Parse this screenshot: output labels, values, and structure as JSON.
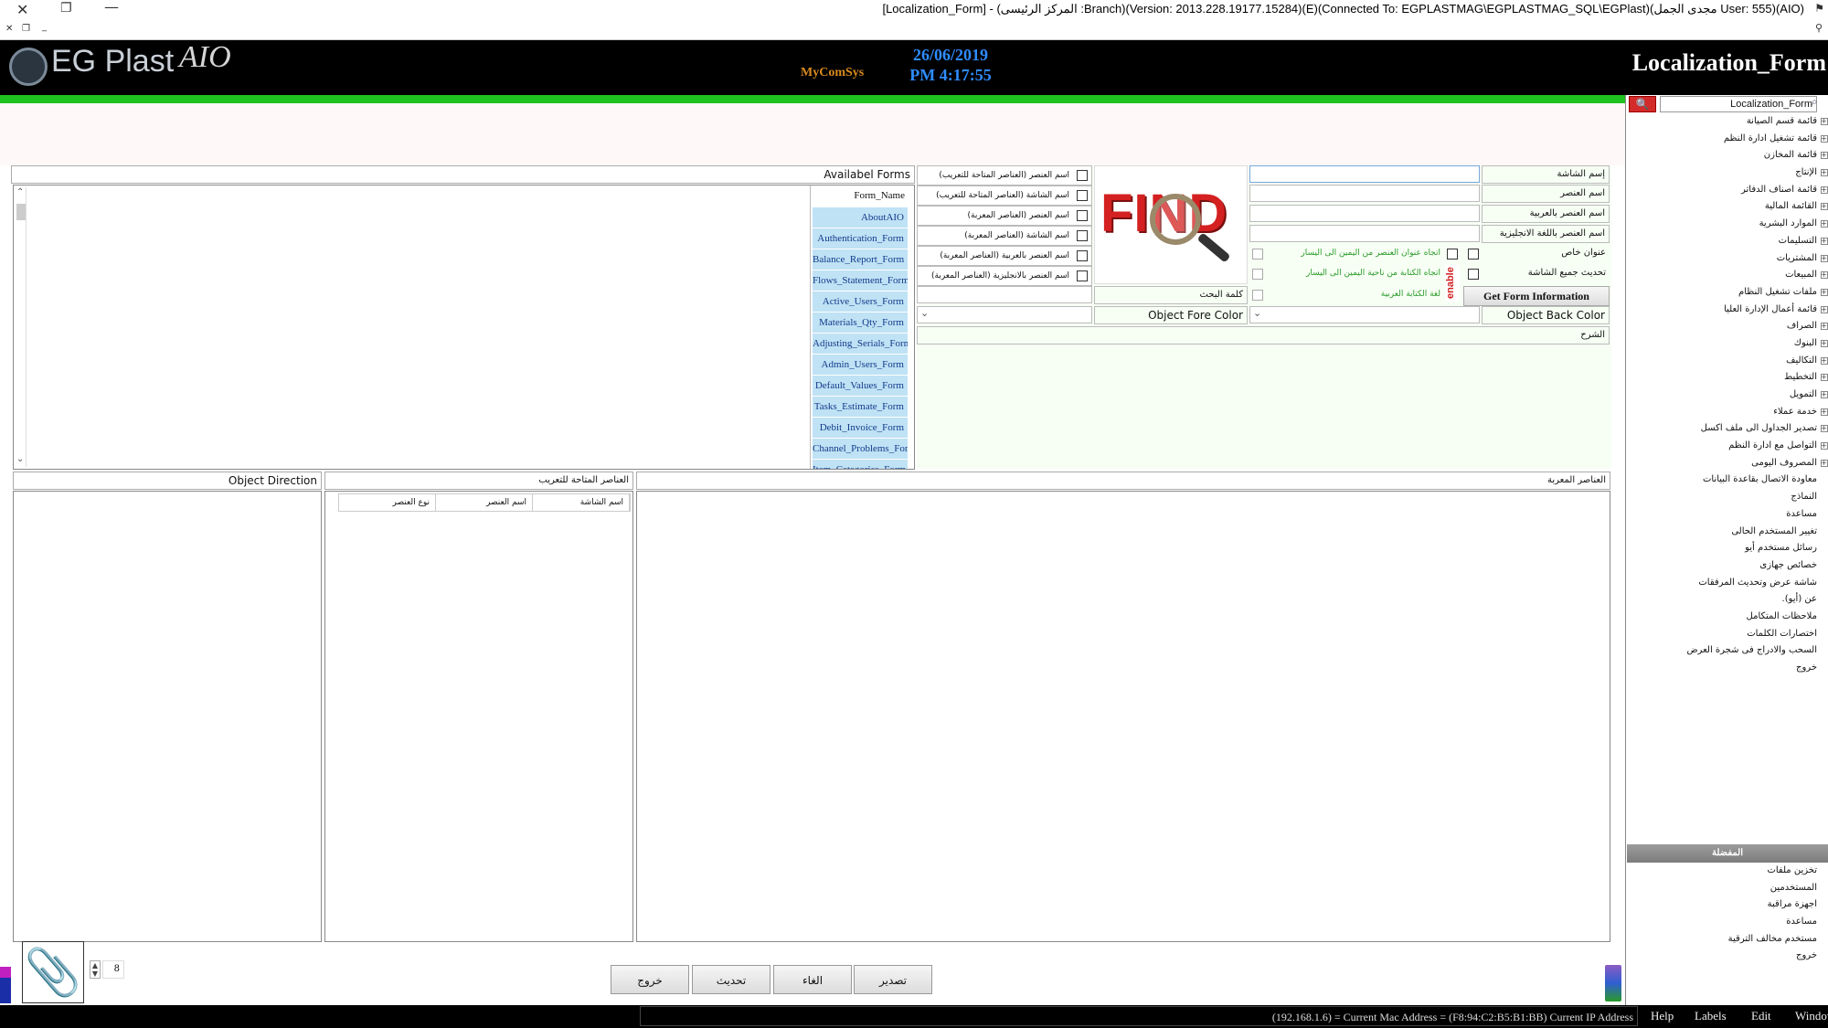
{
  "titlebar": {
    "title": "[Localization_Form] - (المركز الرئيسى :Branch)(Version: 2013.228.19177.15284)(E)(Connected To: EGPLASTMAG\\EGPLASTMAG_SQL\\EGPlast)(مجدى الجمل User: 555)(AIO)"
  },
  "header": {
    "logo": "EG Plast",
    "logo_suffix": "AIO",
    "brand": "MyComSys",
    "date": "26/06/2019",
    "time": "PM 4:17:55",
    "form_title": "Localization_Form"
  },
  "sidebar": {
    "search_value": "Localization_Form",
    "items": [
      {
        "label": "قائمة قسم الصيانة",
        "expandable": true
      },
      {
        "label": "قائمة تشغيل ادارة النظم",
        "expandable": true
      },
      {
        "label": "قائمة المخازن",
        "expandable": true
      },
      {
        "label": "الإنتاج",
        "expandable": true
      },
      {
        "label": "قائمة اصناف الدفاتر",
        "expandable": true
      },
      {
        "label": "القائمة المالية",
        "expandable": true
      },
      {
        "label": "الموارد البشرية",
        "expandable": true
      },
      {
        "label": "التسليمات",
        "expandable": true
      },
      {
        "label": "المشتريات",
        "expandable": true
      },
      {
        "label": "المبيعات",
        "expandable": true
      },
      {
        "label": "ملفات تشغيل النظام",
        "expandable": true
      },
      {
        "label": "قائمة أعمال الإدارة العليا",
        "expandable": true
      },
      {
        "label": "الصراف",
        "expandable": true
      },
      {
        "label": "البنوك",
        "expandable": true
      },
      {
        "label": "التكاليف",
        "expandable": true
      },
      {
        "label": "التخطيط",
        "expandable": true
      },
      {
        "label": "التمويل",
        "expandable": true
      },
      {
        "label": "خدمة عملاء",
        "expandable": true
      },
      {
        "label": "تصدير الجداول الى ملف اكسل",
        "expandable": true
      },
      {
        "label": "التواصل مع ادارة النظم",
        "expandable": true
      },
      {
        "label": "المصروف اليومى",
        "expandable": true
      },
      {
        "label": "معاودة الاتصال بقاعدة البيانات",
        "expandable": false
      },
      {
        "label": "النماذج",
        "expandable": false
      },
      {
        "label": "مساعدة",
        "expandable": false
      },
      {
        "label": "تغيير المستخدم الحالى",
        "expandable": false
      },
      {
        "label": "رسائل مستخدم أيو",
        "expandable": false
      },
      {
        "label": "خصائص جهازى",
        "expandable": false
      },
      {
        "label": "شاشة عرض وتحديث المرفقات",
        "expandable": false
      },
      {
        "label": "عن (أيو).",
        "expandable": false
      },
      {
        "label": "ملاحظات المتكامل",
        "expandable": false
      },
      {
        "label": "اختصارات الكلمات",
        "expandable": false
      },
      {
        "label": "السحب والادراج فى شجرة العرض",
        "expandable": false
      },
      {
        "label": "خروج",
        "expandable": false
      }
    ],
    "favorites_title": "المفضلة",
    "favorites": [
      "تخزين ملفات",
      "المستخدمين",
      "اجهزة مراقبة",
      "مساعدة",
      "مستخدم مخالف الترقية",
      "خروج"
    ]
  },
  "form": {
    "screen_name_label": "إسم الشاشة",
    "object_name_label": "اسم العنصر",
    "object_arabic_label": "اسم العنصر بالعربية",
    "object_english_label": "اسم العنصر باللغة الانجليزية",
    "special_title_label": "عنوان خاص",
    "update_all_label": "تحديث جميع الشاشة",
    "direction_rtl_label": "اتجاه عنوان العنصر من اليمين الى اليسار",
    "writing_dir_label": "اتجاه الكتابة من ناحية اليمين الى اليسار",
    "arabic_lang_label": "لغة الكتابة العربية",
    "enable_label": "enable",
    "get_info_button": "Get Form Information",
    "object_back_color_label": "Object Back Color",
    "object_fore_color_label": "Object Fore Color",
    "search_word_label": "كلمة البحث",
    "description_label": "الشرح",
    "find_image_text": "FIND",
    "filters": [
      "اسم العنصر (العناصر المتاحة للتعريب)",
      "اسم الشاشة (العناصر المتاحة للتعريب)",
      "اسم العنصر (العناصر المعربة)",
      "اسم الشاشة (العناصر المعربة)",
      "اسم العنصر بالعربية (العناصر المعربة)",
      "اسم العنصر بالانجليزية (العناصر المعربة)"
    ]
  },
  "available_forms": {
    "title": "Availabel Forms",
    "column": "Form_Name",
    "items": [
      "AboutAIO",
      "Authentication_Form",
      "Balance_Report_Form",
      "Flows_Statement_Form",
      "Active_Users_Form",
      "Materials_Qty_Form",
      "Adjusting_Serials_Form",
      "Admin_Users_Form",
      "Default_Values_Form",
      "Tasks_Estimate_Form",
      "Debit_Invoice_Form",
      "Channel_Problems_Form",
      "Item_Categories_Form"
    ]
  },
  "sections": {
    "object_direction": "Object Direction",
    "available_for_localization": "العناصر المتاحة للتعريب",
    "localized_elements": "العناصر المعربة",
    "columns": [
      "اسم الشاشة",
      "اسم العنصر",
      "نوع العنصر"
    ]
  },
  "bottom": {
    "page_number": "8",
    "buttons": [
      "تصدير",
      "الغاء",
      "تحديث",
      "خروج"
    ]
  },
  "statusbar": {
    "info": "(192.168.1.6) = Current Mac Address = (F8:94:C2:B5:B1:BB) Current IP Address",
    "menus": [
      "Help",
      "Labels",
      "Edit",
      "Windows"
    ]
  },
  "colors": {
    "header_bg": "#000000",
    "accent_green": "#1fc21f",
    "date_blue": "#2f8cff",
    "list_button_bg": "#bfe2f5",
    "search_red": "#d32a2a"
  }
}
